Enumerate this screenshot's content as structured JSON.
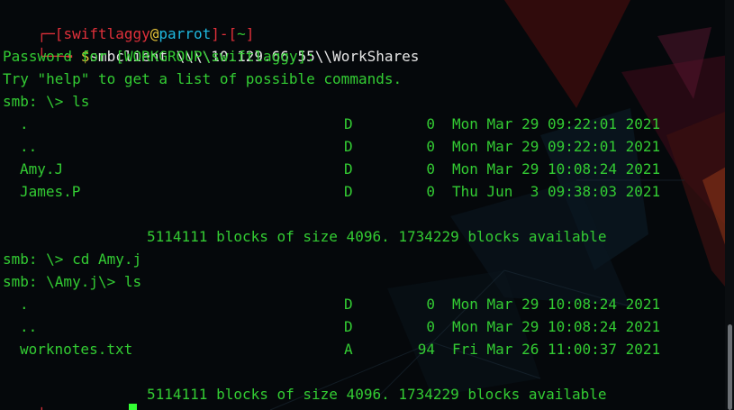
{
  "prompt": {
    "open_bracket": "[",
    "user": "swiftlaggy",
    "at": "@",
    "host": "parrot",
    "close_bracket": "]",
    "dash": "-",
    "dir_open": "[",
    "dir": "~",
    "dir_close": "]",
    "dollar": "$",
    "command": "smbclient \\\\\\\\10.129.66.55\\\\WorkShares"
  },
  "lines": {
    "password": "Password for [WORKGROUP\\swiftlaggy]:",
    "help": "Try \"help\" to get a list of possible commands.",
    "cmd_ls_1": "smb: \\> ls",
    "blocks_1": "5114111 blocks of size 4096. 1734229 blocks available",
    "cmd_cd": "smb: \\> cd Amy.j",
    "cmd_ls_2": "smb: \\Amy.j\\> ls",
    "blocks_2": "5114111 blocks of size 4096. 1734229 blocks available"
  },
  "listing_1": [
    {
      "name": ".",
      "attr": "D",
      "size": "0",
      "date": "Mon Mar 29 09:22:01 2021"
    },
    {
      "name": "..",
      "attr": "D",
      "size": "0",
      "date": "Mon Mar 29 09:22:01 2021"
    },
    {
      "name": "Amy.J",
      "attr": "D",
      "size": "0",
      "date": "Mon Mar 29 10:08:24 2021"
    },
    {
      "name": "James.P",
      "attr": "D",
      "size": "0",
      "date": "Thu Jun  3 09:38:03 2021"
    }
  ],
  "listing_2": [
    {
      "name": ".",
      "attr": "D",
      "size": "0",
      "date": "Mon Mar 29 10:08:24 2021"
    },
    {
      "name": "..",
      "attr": "D",
      "size": "0",
      "date": "Mon Mar 29 10:08:24 2021"
    },
    {
      "name": "worknotes.txt",
      "attr": "A",
      "size": "94",
      "date": "Fri Mar 26 11:00:37 2021"
    }
  ],
  "colors": {
    "background": "#05080b",
    "text_green": "#33cc33",
    "prompt_red": "#e0303a",
    "host_cyan": "#1fb9e0",
    "at_yellow": "#e8c53a",
    "cursor": "#33ff33"
  }
}
